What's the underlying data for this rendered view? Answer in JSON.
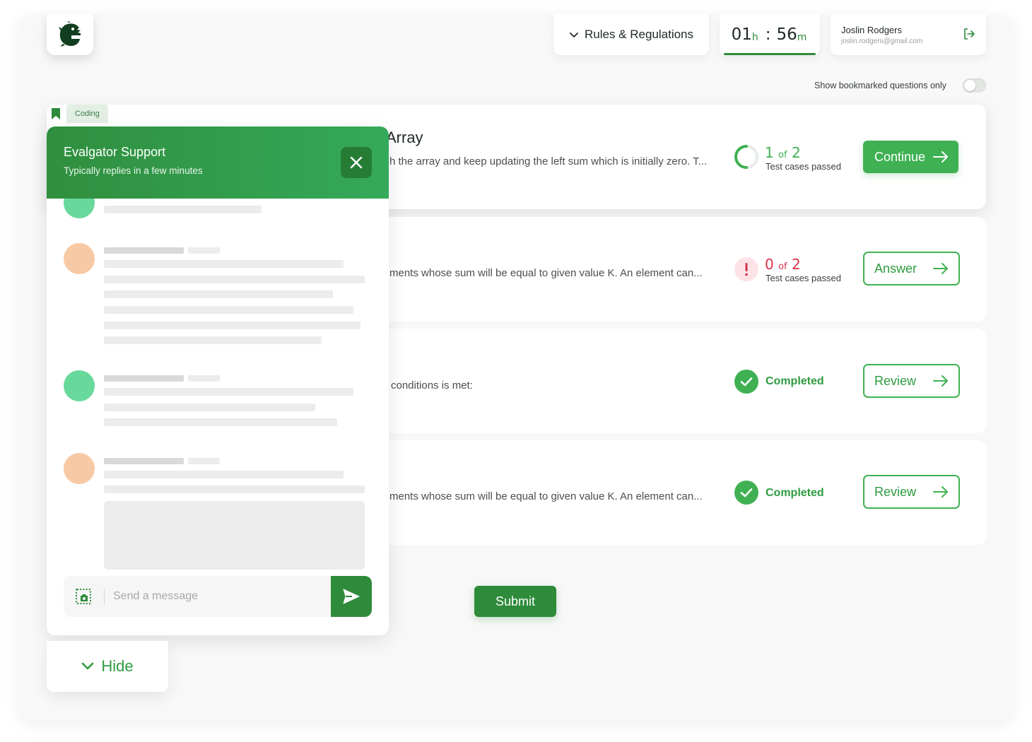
{
  "header": {
    "logo": "evalgator-logo-icon",
    "rules_label": "Rules & Regulations",
    "timer": {
      "hours": "01",
      "hours_unit": "h",
      "separator": ":",
      "minutes": "56",
      "minutes_unit": "m"
    },
    "user": {
      "name": "Joslin Rodgers",
      "email": "joslin.rodgers@gmail.com"
    }
  },
  "bookmark_toggle": {
    "label": "Show bookmarked questions only",
    "on": false
  },
  "question_tags": [
    "Coding"
  ],
  "questions": [
    {
      "title": "Array",
      "description": "h the array and keep updating the left sum which is initially zero. T...",
      "status": "partial",
      "passed": "1",
      "of": "of",
      "total": "2",
      "status_sub": "Test cases passed",
      "action": "Continue"
    },
    {
      "title": "",
      "description": "ments whose sum will be equal to given value K. An element can...",
      "status": "failed",
      "passed": "0",
      "of": "of",
      "total": "2",
      "status_sub": "Test cases passed",
      "action": "Answer"
    },
    {
      "title": "",
      "description": "conditions is met:",
      "status": "completed",
      "status_label": "Completed",
      "action": "Review"
    },
    {
      "title": "",
      "description": "ments whose sum will be equal to given value K. An element can...",
      "status": "completed",
      "status_label": "Completed",
      "action": "Review"
    }
  ],
  "submit_label": "Submit",
  "chat": {
    "title": "Evalgator Support",
    "subtitle": "Typically replies in a few minutes",
    "input_placeholder": "Send a message",
    "hide_label": "Hide"
  },
  "colors": {
    "primary": "#2e8b3a",
    "accent": "#3fb153",
    "error": "#d8314d",
    "chat_header": "#2f8f3e"
  }
}
